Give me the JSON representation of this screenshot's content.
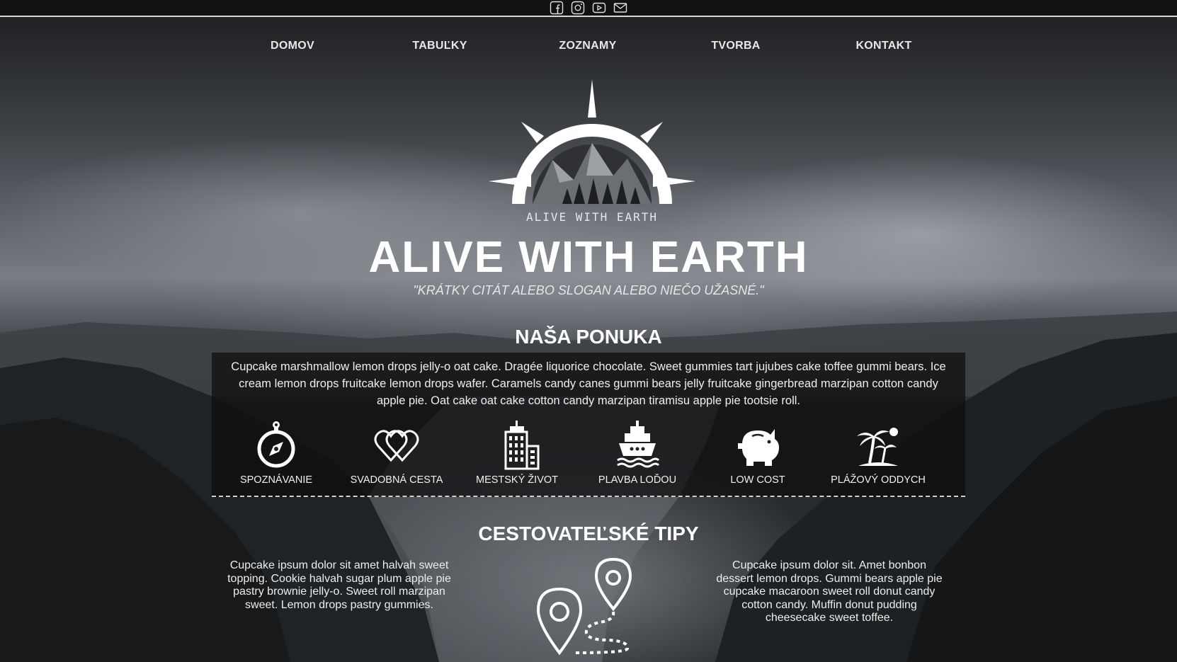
{
  "topbar": {
    "social": [
      {
        "icon": "facebook-icon"
      },
      {
        "icon": "instagram-icon"
      },
      {
        "icon": "youtube-icon"
      },
      {
        "icon": "mail-icon"
      }
    ]
  },
  "nav": {
    "items": [
      {
        "label": "DOMOV"
      },
      {
        "label": "TABUĽKY"
      },
      {
        "label": "ZOZNAMY"
      },
      {
        "label": "TVORBA"
      },
      {
        "label": "KONTAKT"
      }
    ]
  },
  "logo": {
    "icon": "compass-mountain-logo",
    "text": "ALIVE WITH EARTH"
  },
  "hero": {
    "title": "ALIVE WITH EARTH",
    "slogan": "\"KRÁTKY CITÁT ALEBO SLOGAN ALEBO NIEČO UŽASNÉ.\""
  },
  "offer": {
    "title": "NAŠA PONUKA",
    "text": "Cupcake marshmallow lemon drops jelly-o oat cake. Dragée liquorice chocolate. Sweet gummies tart jujubes cake toffee gummi bears. Ice cream lemon drops fruitcake lemon drops wafer. Caramels candy canes gummi bears jelly fruitcake gingerbread marzipan cotton candy apple pie. Oat cake oat cake cotton candy marzipan tiramisu apple pie tootsie roll.",
    "items": [
      {
        "label": "SPOZNÁVANIE",
        "icon": "compass-icon"
      },
      {
        "label": "SVADOBNÁ CESTA",
        "icon": "hearts-icon"
      },
      {
        "label": "MESTSKÝ ŽIVOT",
        "icon": "city-buildings-icon"
      },
      {
        "label": "PLAVBA LOĎOU",
        "icon": "ship-icon"
      },
      {
        "label": "LOW COST",
        "icon": "piggy-bank-icon"
      },
      {
        "label": "PLÁŽOVÝ ODDYCH",
        "icon": "palm-island-icon"
      }
    ]
  },
  "tips": {
    "title": "CESTOVATEĽSKÉ TIPY",
    "left_text": "Cupcake ipsum dolor sit amet halvah sweet topping. Cookie halvah sugar plum apple pie pastry brownie jelly-o. Sweet roll marzipan sweet. Lemon drops pastry gummies.",
    "right_text": "Cupcake ipsum dolor sit. Amet bonbon dessert lemon drops. Gummi bears apple pie cupcake macaroon sweet roll donut candy cotton candy. Muffin donut pudding cheesecake sweet toffee.",
    "icon": "route-pins-icon"
  },
  "colors": {
    "topbar": "#111214",
    "text": "#ffffff",
    "offer_box": "rgba(12,12,14,0.72)"
  }
}
